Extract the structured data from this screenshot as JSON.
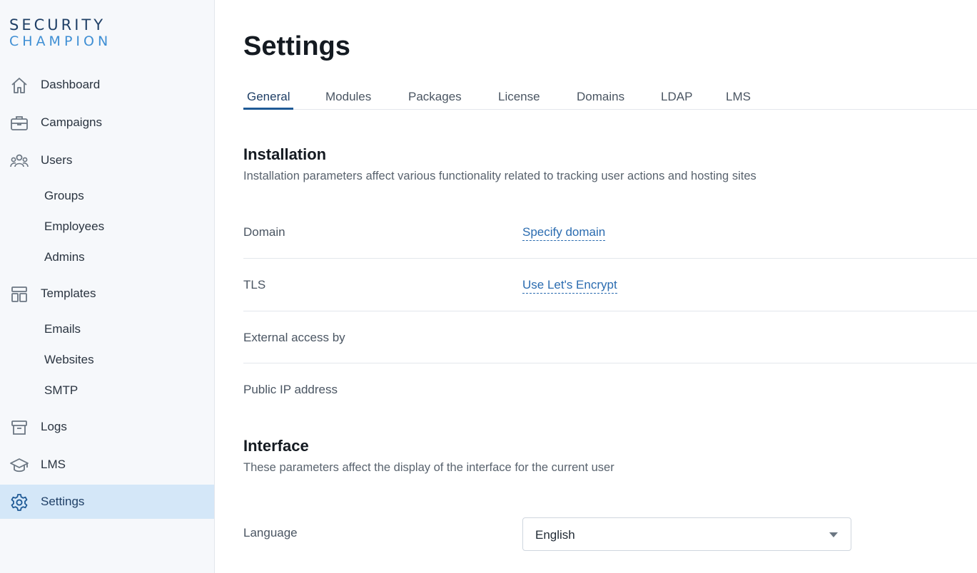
{
  "logo": {
    "line1": "SECURITY",
    "line2": "CHAMPION"
  },
  "sidebar": {
    "items": [
      {
        "label": "Dashboard",
        "icon": "home-icon"
      },
      {
        "label": "Campaigns",
        "icon": "briefcase-icon"
      },
      {
        "label": "Users",
        "icon": "users-icon"
      },
      {
        "label": "Groups"
      },
      {
        "label": "Employees"
      },
      {
        "label": "Admins"
      },
      {
        "label": "Templates",
        "icon": "layout-icon"
      },
      {
        "label": "Emails"
      },
      {
        "label": "Websites"
      },
      {
        "label": "SMTP"
      },
      {
        "label": "Logs",
        "icon": "archive-icon"
      },
      {
        "label": "LMS",
        "icon": "graduation-cap-icon"
      },
      {
        "label": "Settings",
        "icon": "gear-icon",
        "active": true
      }
    ]
  },
  "page": {
    "title": "Settings"
  },
  "tabs": [
    "General",
    "Modules",
    "Packages",
    "License",
    "Domains",
    "LDAP",
    "LMS"
  ],
  "active_tab": "General",
  "installation": {
    "title": "Installation",
    "description": "Installation parameters affect various functionality related to tracking user actions and hosting sites",
    "rows": [
      {
        "label": "Domain",
        "value": "Specify domain"
      },
      {
        "label": "TLS",
        "value": "Use Let's Encrypt"
      },
      {
        "label": "External access by",
        "value": ""
      },
      {
        "label": "Public IP address",
        "value": ""
      }
    ]
  },
  "interface": {
    "title": "Interface",
    "description": "These parameters affect the display of the interface for the current user",
    "language_label": "Language",
    "language_value": "English"
  },
  "colors": {
    "accent": "#1f5a96",
    "link": "#2b6cb0",
    "active_bg": "#d4e7f8",
    "sidebar_bg": "#f6f8fb"
  }
}
